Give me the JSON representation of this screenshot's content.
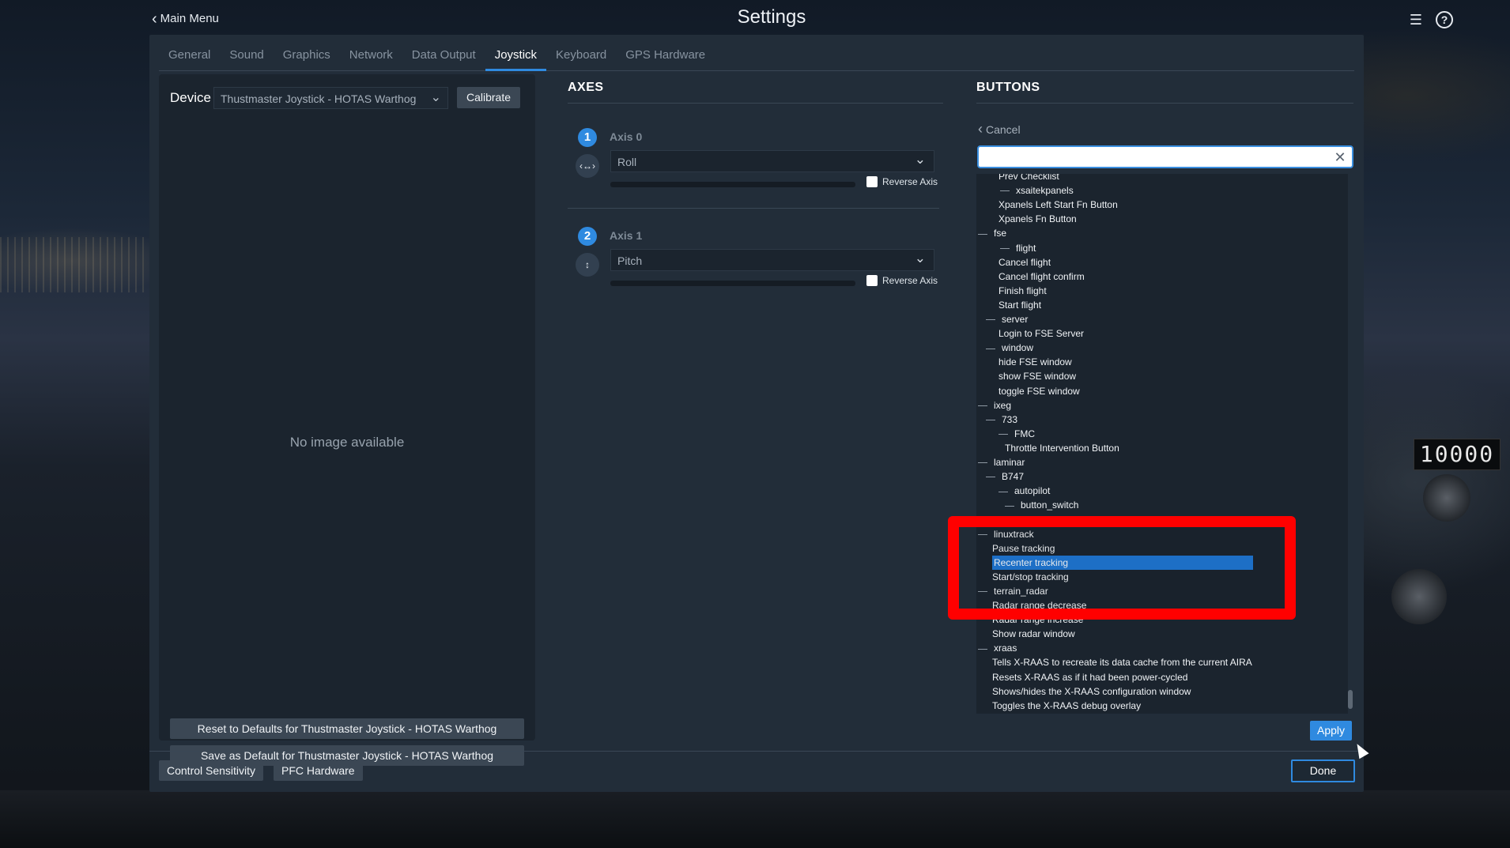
{
  "window": {
    "title": "Settings",
    "back_label": "Main Menu"
  },
  "tabs": [
    "General",
    "Sound",
    "Graphics",
    "Network",
    "Data Output",
    "Joystick",
    "Keyboard",
    "GPS Hardware"
  ],
  "active_tab": "Joystick",
  "device": {
    "label": "Device",
    "selected": "Thustmaster Joystick - HOTAS Warthog",
    "calibrate_label": "Calibrate",
    "no_image_text": "No image available",
    "reset_label": "Reset to Defaults for Thustmaster Joystick - HOTAS Warthog",
    "save_label": "Save as Default for Thustmaster Joystick - HOTAS Warthog"
  },
  "axes": {
    "title": "AXES",
    "items": [
      {
        "number": "1",
        "name": "Axis 0",
        "assignment": "Roll",
        "reverse_label": "Reverse Axis"
      },
      {
        "number": "2",
        "name": "Axis 1",
        "assignment": "Pitch",
        "reverse_label": "Reverse Axis"
      }
    ]
  },
  "buttons": {
    "title": "BUTTONS",
    "cancel_label": "Cancel",
    "search_value": "",
    "apply_label": "Apply",
    "tree": [
      {
        "text": "Prev Checklist",
        "group": false
      },
      {
        "text": "xsaitekpanels",
        "group": true
      },
      {
        "text": "Xpanels Left Start Fn Button",
        "group": false
      },
      {
        "text": "Xpanels Fn Button",
        "group": false
      },
      {
        "text": "fse",
        "group": true
      },
      {
        "text": "flight",
        "group": true
      },
      {
        "text": "Cancel flight",
        "group": false
      },
      {
        "text": "Cancel flight confirm",
        "group": false
      },
      {
        "text": "Finish flight",
        "group": false
      },
      {
        "text": "Start flight",
        "group": false
      },
      {
        "text": "server",
        "group": true
      },
      {
        "text": "Login to FSE Server",
        "group": false
      },
      {
        "text": "window",
        "group": true
      },
      {
        "text": "hide FSE window",
        "group": false
      },
      {
        "text": "show FSE window",
        "group": false
      },
      {
        "text": "toggle FSE window",
        "group": false
      },
      {
        "text": "ixeg",
        "group": true
      },
      {
        "text": "733",
        "group": true
      },
      {
        "text": "FMC",
        "group": true
      },
      {
        "text": "Throttle Intervention Button",
        "group": false
      },
      {
        "text": "laminar",
        "group": true
      },
      {
        "text": "B747",
        "group": true
      },
      {
        "text": "autopilot",
        "group": true
      },
      {
        "text": "button_switch",
        "group": true
      },
      {
        "text": "",
        "group": false
      },
      {
        "text": "linuxtrack",
        "group": true
      },
      {
        "text": "Pause tracking",
        "group": false
      },
      {
        "text": "Recenter tracking",
        "group": false,
        "selected": true
      },
      {
        "text": "Start/stop tracking",
        "group": false
      },
      {
        "text": "terrain_radar",
        "group": true
      },
      {
        "text": "Radar range decrease",
        "group": false
      },
      {
        "text": "Radar range increase",
        "group": false
      },
      {
        "text": "Show radar window",
        "group": false
      },
      {
        "text": "xraas",
        "group": true
      },
      {
        "text": "Tells X-RAAS to recreate its data cache from the current AIRA",
        "group": false
      },
      {
        "text": "Resets X-RAAS as if it had been power-cycled",
        "group": false
      },
      {
        "text": "Shows/hides the X-RAAS configuration window",
        "group": false
      },
      {
        "text": "Toggles the X-RAAS debug overlay",
        "group": false
      }
    ]
  },
  "footer": {
    "control_sensitivity_label": "Control Sensitivity",
    "pfc_label": "PFC Hardware",
    "done_label": "Done"
  },
  "background": {
    "altitude_readout": "10000"
  },
  "colors": {
    "accent": "#2f8ae0",
    "highlight": "#ff0000",
    "dialog": "#222d39"
  }
}
